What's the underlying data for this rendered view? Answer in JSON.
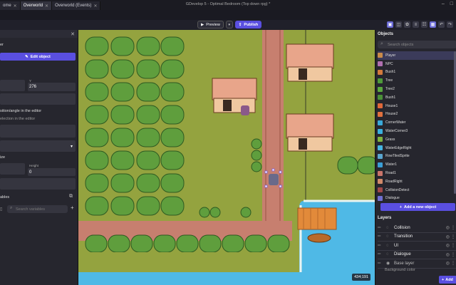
{
  "window": {
    "title": "GDevelop 5 - Optimal Bedroom (Top down rpg) *",
    "tabs": [
      {
        "label": "ome"
      },
      {
        "label": "Overworld"
      },
      {
        "label": "Overworld (Events)"
      }
    ]
  },
  "toolbar": {
    "preview_label": "Preview",
    "publish_label": "Publish"
  },
  "left_panel": {
    "section_label": "er",
    "edit_label": "Edit object",
    "x_value": "",
    "y_label": "Y",
    "y_value": "276",
    "sync_label": "sition/angle in the editor",
    "selection_label": "election in the editor",
    "size_label": "ize",
    "height_label": "Height",
    "height_value": "0",
    "variables_label": "ables",
    "search_placeholder": "Search variables"
  },
  "canvas": {
    "cursor_coords": "434;191"
  },
  "objects_panel": {
    "title": "Objects",
    "search_placeholder": "Search objects",
    "add_label": "Add a new object",
    "items": [
      {
        "label": "Player",
        "color": "#c98a4a"
      },
      {
        "label": "NPC",
        "color": "#b06fb0"
      },
      {
        "label": "Bush1",
        "color": "#d27a3c"
      },
      {
        "label": "Tree",
        "color": "#4e9a3a"
      },
      {
        "label": "Tree2",
        "color": "#5aa83f"
      },
      {
        "label": "Bush1",
        "color": "#4a8f38"
      },
      {
        "label": "House1",
        "color": "#e0683a"
      },
      {
        "label": "House2",
        "color": "#e0703e"
      },
      {
        "label": "CornerWater",
        "color": "#3aa9d8"
      },
      {
        "label": "WaterCorner3",
        "color": "#3ab0de"
      },
      {
        "label": "Grass",
        "color": "#7fb23e"
      },
      {
        "label": "WaterEdgeRight",
        "color": "#45b4e0"
      },
      {
        "label": "RowTiledSprite",
        "color": "#5aa6d0"
      },
      {
        "label": "Water1",
        "color": "#3a9ed6"
      },
      {
        "label": "Road1",
        "color": "#c9746a"
      },
      {
        "label": "RoadRight",
        "color": "#d08a6a"
      },
      {
        "label": "CollisionDetect",
        "color": "#a04848"
      },
      {
        "label": "Dialogue",
        "color": "#6f6fd0"
      }
    ]
  },
  "layers_panel": {
    "title": "Layers",
    "items": [
      {
        "label": "Collision"
      },
      {
        "label": "Transition"
      },
      {
        "label": "UI"
      },
      {
        "label": "Dialogue"
      },
      {
        "label": "Base layer"
      }
    ],
    "background_label": "Background color",
    "add_label": "Add"
  }
}
